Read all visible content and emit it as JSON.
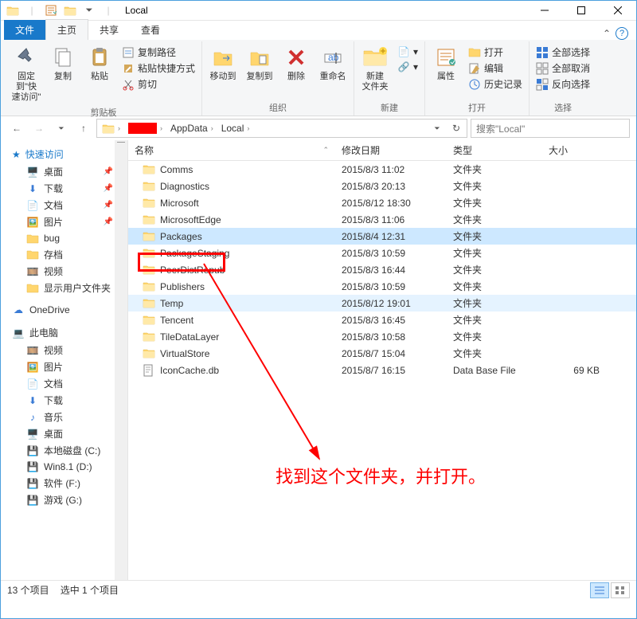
{
  "window": {
    "title": "Local"
  },
  "ribbonTabs": {
    "file": "文件",
    "home": "主页",
    "share": "共享",
    "view": "查看"
  },
  "ribbon": {
    "pin": "固定到\"快\n速访问\"",
    "copy": "复制",
    "paste": "粘贴",
    "copyPath": "复制路径",
    "pasteShortcut": "粘贴快捷方式",
    "cut": "剪切",
    "clipboard": "剪贴板",
    "moveTo": "移动到",
    "copyTo": "复制到",
    "delete": "删除",
    "rename": "重命名",
    "organize": "组织",
    "newFolder": "新建\n文件夹",
    "new": "新建",
    "properties": "属性",
    "open": "打开",
    "edit": "编辑",
    "history": "历史记录",
    "openGrp": "打开",
    "selectAll": "全部选择",
    "selectNone": "全部取消",
    "invertSel": "反向选择",
    "select": "选择"
  },
  "breadcrumbs": [
    "AppData",
    "Local"
  ],
  "search": {
    "placeholder": "搜索\"Local\""
  },
  "sidebar": {
    "quickAccess": "快速访问",
    "desktop": "桌面",
    "downloads": "下载",
    "documents": "文档",
    "pictures": "图片",
    "bug": "bug",
    "archive": "存档",
    "videosZh": "视频",
    "showUserFolder": "显示用户文件夹",
    "onedrive": "OneDrive",
    "thisPC": "此电脑",
    "videos": "视频",
    "pictures2": "图片",
    "documents2": "文档",
    "downloads2": "下载",
    "music": "音乐",
    "desktop2": "桌面",
    "localDisk": "本地磁盘 (C:)",
    "win81": "Win8.1 (D:)",
    "soft": "软件 (F:)",
    "games": "游戏 (G:)"
  },
  "columns": {
    "name": "名称",
    "date": "修改日期",
    "type": "类型",
    "size": "大小"
  },
  "typeFolder": "文件夹",
  "typeDb": "Data Base File",
  "files": [
    {
      "name": "Comms",
      "date": "2015/8/3 11:02",
      "type": "folder"
    },
    {
      "name": "Diagnostics",
      "date": "2015/8/3 20:13",
      "type": "folder"
    },
    {
      "name": "Microsoft",
      "date": "2015/8/12 18:30",
      "type": "folder"
    },
    {
      "name": "MicrosoftEdge",
      "date": "2015/8/3 11:06",
      "type": "folder"
    },
    {
      "name": "Packages",
      "date": "2015/8/4 12:31",
      "type": "folder",
      "sel": true
    },
    {
      "name": "PackageStaging",
      "date": "2015/8/3 10:59",
      "type": "folder"
    },
    {
      "name": "PeerDistRepub",
      "date": "2015/8/3 16:44",
      "type": "folder"
    },
    {
      "name": "Publishers",
      "date": "2015/8/3 10:59",
      "type": "folder"
    },
    {
      "name": "Temp",
      "date": "2015/8/12 19:01",
      "type": "folder",
      "hover": true
    },
    {
      "name": "Tencent",
      "date": "2015/8/3 16:45",
      "type": "folder"
    },
    {
      "name": "TileDataLayer",
      "date": "2015/8/3 10:58",
      "type": "folder"
    },
    {
      "name": "VirtualStore",
      "date": "2015/8/7 15:04",
      "type": "folder"
    },
    {
      "name": "IconCache.db",
      "date": "2015/8/7 16:15",
      "type": "db",
      "size": "69 KB"
    }
  ],
  "annotation": "找到这个文件夹，并打开。",
  "status": {
    "count": "13 个项目",
    "selected": "选中 1 个项目"
  }
}
